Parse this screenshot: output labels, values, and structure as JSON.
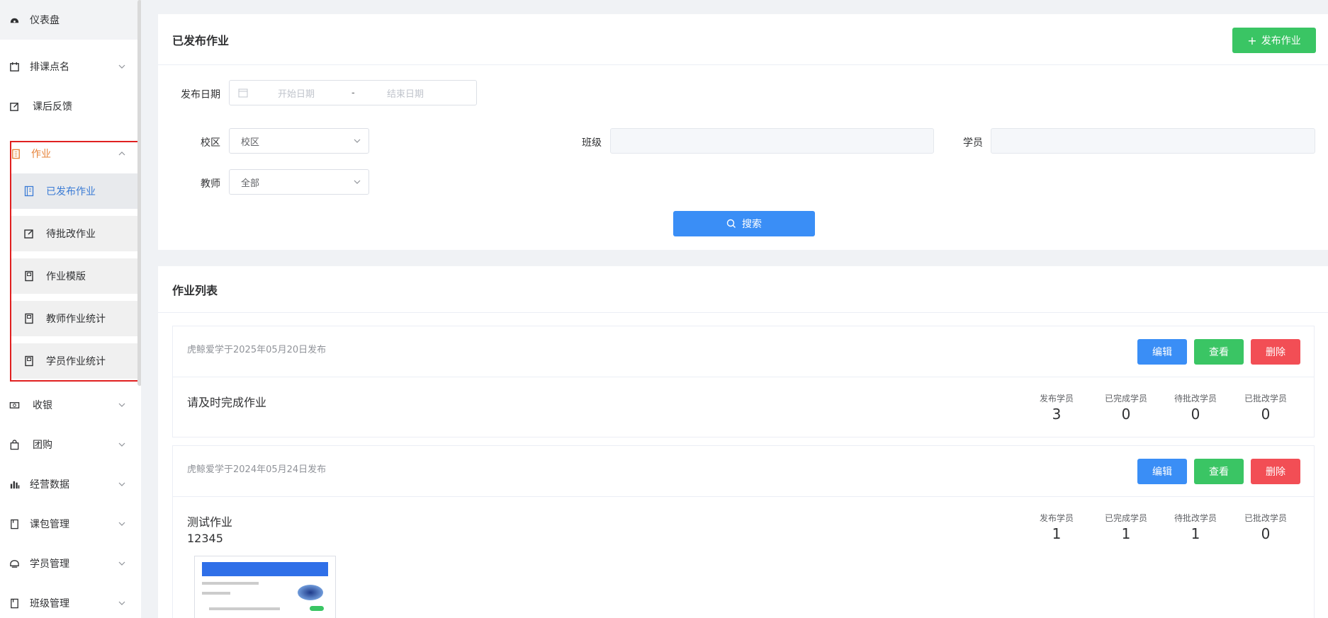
{
  "sidebar": {
    "items": [
      {
        "label": "仪表盘",
        "icon": "dashboard-icon"
      },
      {
        "label": "排课点名",
        "icon": "calendar-icon"
      },
      {
        "label": "课后反馈",
        "icon": "edit-icon"
      },
      {
        "label": "作业",
        "icon": "document-icon"
      },
      {
        "label": "收银",
        "icon": "cashier-icon"
      },
      {
        "label": "团购",
        "icon": "bag-icon"
      },
      {
        "label": "经营数据",
        "icon": "bar-chart-icon"
      },
      {
        "label": "课包管理",
        "icon": "package-icon"
      },
      {
        "label": "学员管理",
        "icon": "student-icon"
      },
      {
        "label": "班级管理",
        "icon": "class-icon"
      }
    ],
    "sub_items": [
      {
        "label": "已发布作业"
      },
      {
        "label": "待批改作业"
      },
      {
        "label": "作业模版"
      },
      {
        "label": "教师作业统计"
      },
      {
        "label": "学员作业统计"
      }
    ]
  },
  "filter": {
    "title": "已发布作业",
    "publish_button": "发布作业",
    "date_label": "发布日期",
    "start_placeholder": "开始日期",
    "range_sep": "-",
    "end_placeholder": "结束日期",
    "campus_label": "校区",
    "campus_value": "校区",
    "class_label": "班级",
    "student_label": "学员",
    "teacher_label": "教师",
    "teacher_value": "全部",
    "search_button": "搜索"
  },
  "list": {
    "title": "作业列表",
    "edit": "编辑",
    "view": "查看",
    "delete": "删除",
    "stat_labels": [
      "发布学员",
      "已完成学员",
      "待批改学员",
      "已批改学员"
    ],
    "items": [
      {
        "meta": "虎鲸爱学于2025年05月20日发布",
        "title": "请及时完成作业",
        "desc": "",
        "stats": [
          "3",
          "0",
          "0",
          "0"
        ]
      },
      {
        "meta": "虎鲸爱学于2024年05月24日发布",
        "title": "测试作业",
        "desc": "12345",
        "stats": [
          "1",
          "1",
          "1",
          "0"
        ]
      }
    ]
  },
  "colors": {
    "accent": "#e6833a",
    "primary": "#3a8ef6",
    "success": "#3ac564",
    "danger": "#f24e55",
    "highlight_box": "#e02020"
  }
}
